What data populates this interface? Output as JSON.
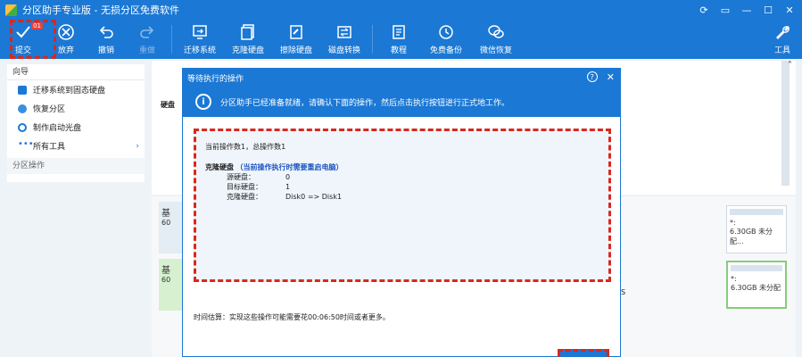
{
  "window": {
    "title": "分区助手专业版 - 无损分区免费软件"
  },
  "toolbar": {
    "commit": {
      "label": "提交",
      "badge": "01"
    },
    "discard": {
      "label": "放弃"
    },
    "undo": {
      "label": "撤销"
    },
    "redo": {
      "label": "重做"
    },
    "migrate": {
      "label": "迁移系统"
    },
    "clone": {
      "label": "克隆硬盘"
    },
    "wipe": {
      "label": "擦除硬盘"
    },
    "convert": {
      "label": "磁盘转换"
    },
    "tutorial": {
      "label": "教程"
    },
    "backup": {
      "label": "免费备份"
    },
    "wechat": {
      "label": "微信恢复"
    },
    "tools": {
      "label": "工具"
    }
  },
  "sidebar": {
    "guide_header": "向导",
    "items": [
      {
        "label": "迁移系统到固态硬盘",
        "icon": "migrate-icon"
      },
      {
        "label": "恢复分区",
        "icon": "restore-icon"
      },
      {
        "label": "制作启动光盘",
        "icon": "disc-icon"
      },
      {
        "label": "所有工具",
        "icon": "more-icon"
      }
    ],
    "partition_ops_header": "分区操作"
  },
  "main": {
    "disk_label": "硬盘",
    "disk1_prefix": "基",
    "disk1_size": "60",
    "disk2_prefix": "基",
    "disk2_size": "60",
    "part_a_name": "*:",
    "part_a_size": "6.30GB 未分配...",
    "part_b_name": "*:",
    "part_b_size": "6.30GB 未分配",
    "part_b_fs": "S"
  },
  "dialog": {
    "title": "等待执行的操作",
    "info": "分区助手已经准备就绪，请确认下面的操作，然后点击执行按钮进行正式地工作。",
    "op_count": "当前操作数1，总操作数1",
    "op_title": "克隆硬盘",
    "op_note": "（当前操作执行时需要重启电脑）",
    "rows": [
      {
        "key": "源硬盘：",
        "value": "0"
      },
      {
        "key": "目标硬盘：",
        "value": "1"
      },
      {
        "key": "克隆硬盘：",
        "value": "Disk0 => Disk1"
      }
    ],
    "estimate": "时间估算：实现这些操作可能需要花00:06:50时间或者更多。"
  },
  "colors": {
    "brand_blue": "#1b78d4",
    "highlight_red": "#d9281e",
    "selected_green": "#86cc7d"
  }
}
